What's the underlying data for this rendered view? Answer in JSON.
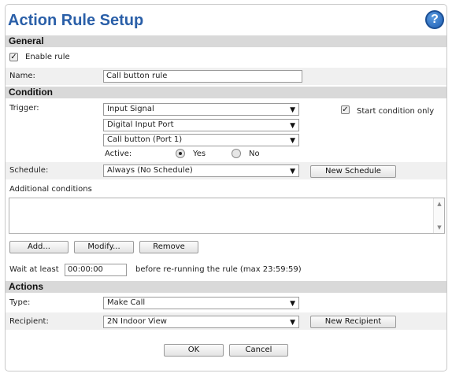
{
  "header": {
    "title": "Action Rule Setup",
    "help_glyph": "?"
  },
  "general": {
    "section_title": "General",
    "enable_rule": {
      "label": "Enable rule",
      "checked": true
    },
    "name": {
      "label": "Name:",
      "value": "Call button rule"
    }
  },
  "condition": {
    "section_title": "Condition",
    "trigger": {
      "label": "Trigger:",
      "signal": "Input Signal",
      "port_type": "Digital Input Port",
      "port": "Call button (Port 1)",
      "active_label": "Active:",
      "yes_label": "Yes",
      "no_label": "No",
      "active_value": "Yes"
    },
    "start_condition_only": {
      "label": "Start condition only",
      "checked": true
    },
    "schedule": {
      "label": "Schedule:",
      "value": "Always (No Schedule)",
      "new_button": "New Schedule"
    },
    "additional": {
      "label": "Additional conditions",
      "add_button": "Add...",
      "modify_button": "Modify...",
      "remove_button": "Remove"
    },
    "wait": {
      "label": "Wait at least",
      "value": "00:00:00",
      "suffix": "before re-running the rule (max 23:59:59)"
    }
  },
  "actions": {
    "section_title": "Actions",
    "type": {
      "label": "Type:",
      "value": "Make Call"
    },
    "recipient": {
      "label": "Recipient:",
      "value": "2N Indoor View",
      "new_button": "New Recipient"
    }
  },
  "footer": {
    "ok_button": "OK",
    "cancel_button": "Cancel"
  }
}
